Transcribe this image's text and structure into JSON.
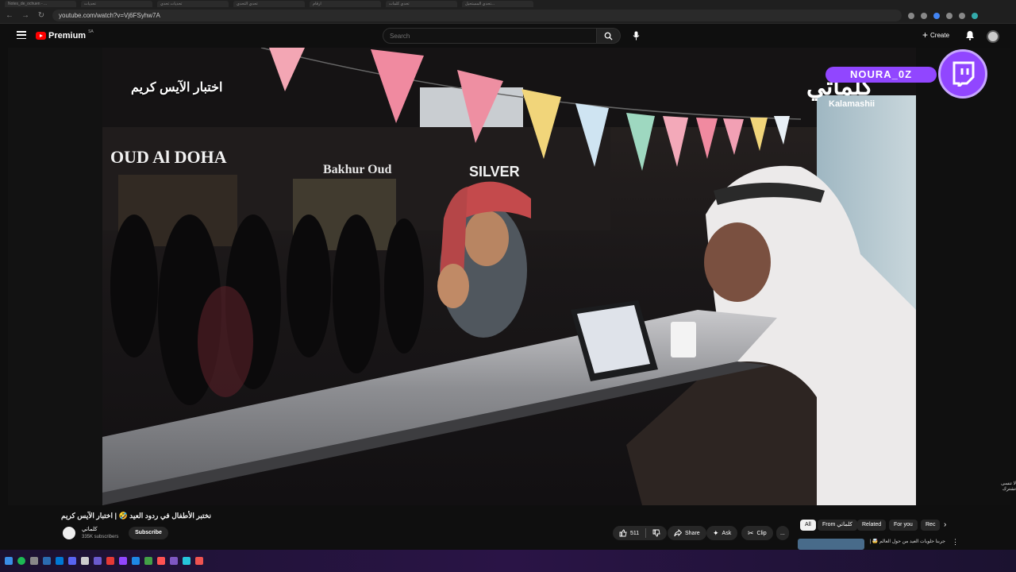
{
  "browser": {
    "tabs": [
      "Notes_de_ochuen - ...",
      "ٍ",
      "تحديات",
      "",
      "تحديات تحدي",
      "",
      "تحدي التحدي",
      "ارقام",
      "تحدي كلمات",
      "تحدي المستحيل..."
    ],
    "url": "youtube.com/watch?v=Vj6FSyhw7A"
  },
  "header": {
    "brand": "Premium",
    "region": "SA",
    "search_placeholder": "Search",
    "create_label": "Create"
  },
  "video": {
    "caption": "اختبار الآيس كريم",
    "brand_arabic": "كلماتي",
    "brand_english": "Kalamashii",
    "overlay_handle": "NOURA_0Z",
    "corner_text": "لا تنسى تشترك"
  },
  "details": {
    "title": "نختبر الأطفال في ردود العيد 🤣 | اختبار الآيس كريم",
    "channel_name": "كلماتي",
    "subscribers": "335K subscribers",
    "subscribe_label": "Subscribe",
    "likes": "511",
    "share_label": "Share",
    "ask_label": "Ask",
    "clip_label": "Clip",
    "more_label": "..."
  },
  "sidebar_chips": [
    {
      "label": "All",
      "active": true
    },
    {
      "label": "From كلماتي",
      "active": false
    },
    {
      "label": "Related",
      "active": false
    },
    {
      "label": "For you",
      "active": false
    },
    {
      "label": "Rec",
      "active": false
    }
  ],
  "recommendation": {
    "title": "جربنا حلويات العيد من حول العالم 🤯 |"
  },
  "colors": {
    "accent_red": "#ff0000",
    "twitch_purple": "#9146ff",
    "background": "#0f0f0f"
  }
}
